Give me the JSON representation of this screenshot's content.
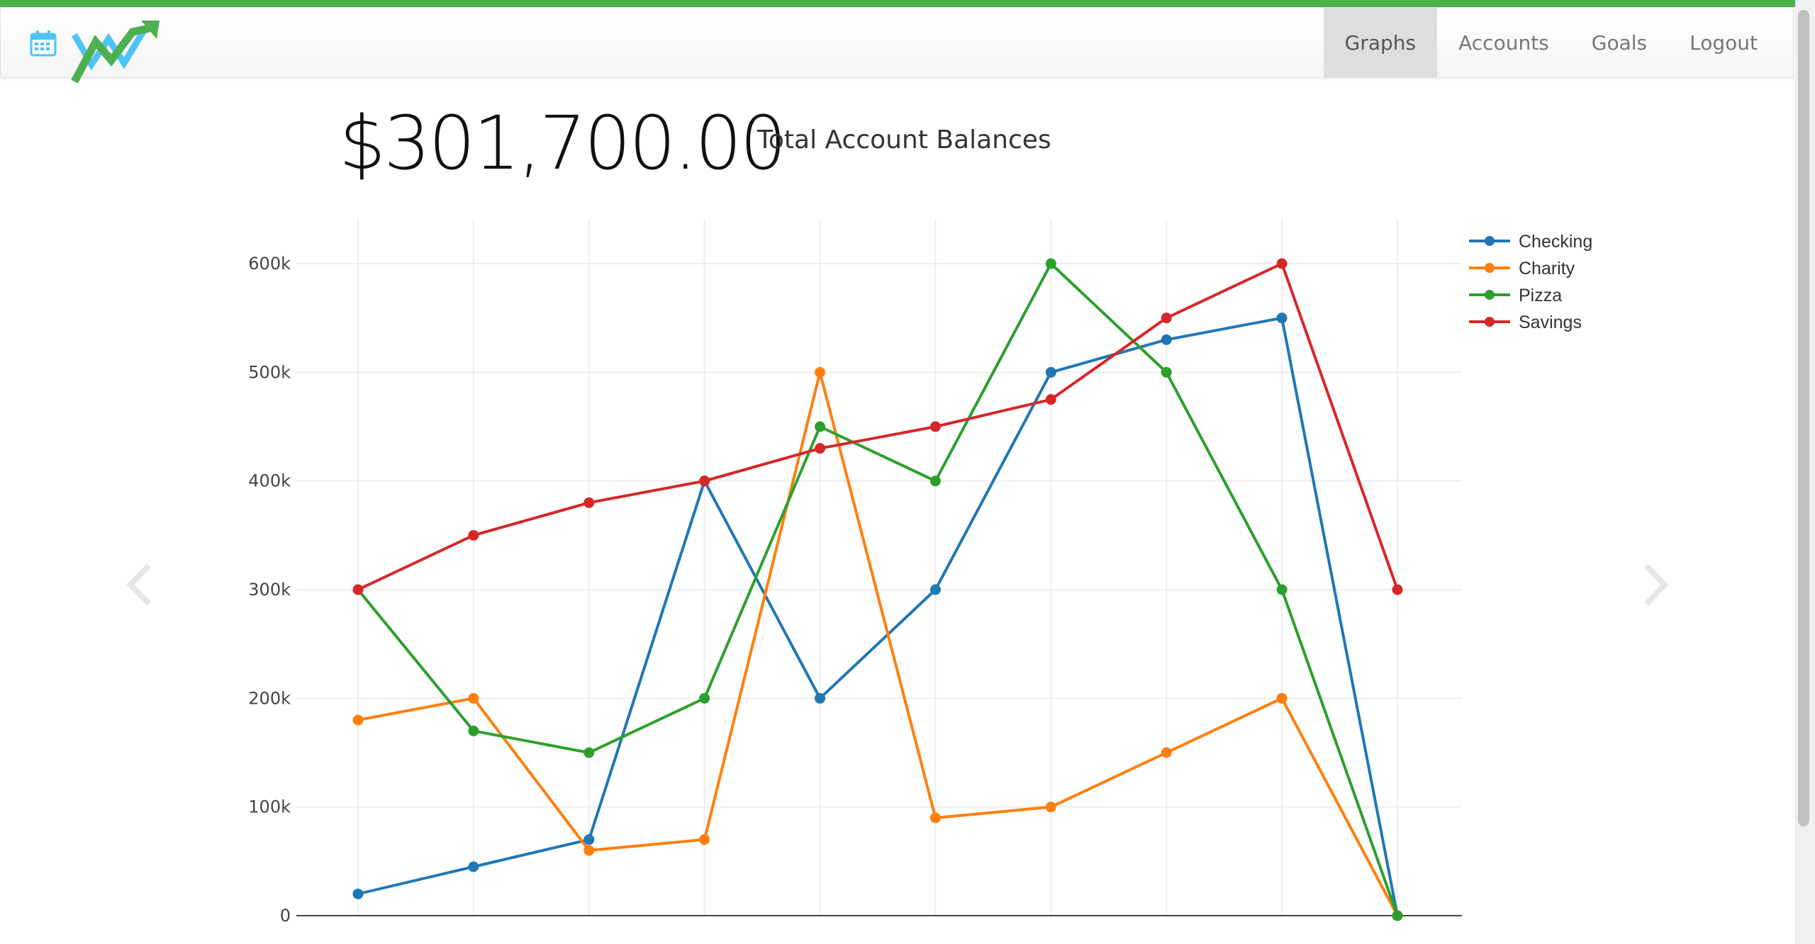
{
  "app": {
    "nav": {
      "items": [
        {
          "label": "Graphs",
          "active": true
        },
        {
          "label": "Accounts",
          "active": false
        },
        {
          "label": "Goals",
          "active": false
        },
        {
          "label": "Logout",
          "active": false
        }
      ]
    },
    "icons": {
      "calendar": "calendar-icon",
      "logo": "trend-arrow-logo",
      "prev": "chevron-left-icon",
      "next": "chevron-right-icon"
    },
    "colors": {
      "accent": "#4caf50",
      "calendar": "#4fc3f7"
    }
  },
  "summary": {
    "balance": "$301,700.00",
    "label": "Total Account Balances"
  },
  "chart_data": {
    "type": "line",
    "x": [
      1,
      2,
      3,
      4,
      5,
      6,
      7,
      8,
      9,
      10
    ],
    "ylim": [
      0,
      600000
    ],
    "yticks": [
      {
        "value": 0,
        "label": "0"
      },
      {
        "value": 100000,
        "label": "100k"
      },
      {
        "value": 200000,
        "label": "200k"
      },
      {
        "value": 300000,
        "label": "300k"
      },
      {
        "value": 400000,
        "label": "400k"
      },
      {
        "value": 500000,
        "label": "500k"
      },
      {
        "value": 600000,
        "label": "600k"
      }
    ],
    "grid": true,
    "legend_position": "top-right",
    "series": [
      {
        "name": "Checking",
        "color": "#1f77b4",
        "values": [
          20000,
          45000,
          70000,
          400000,
          200000,
          300000,
          500000,
          530000,
          550000,
          0
        ]
      },
      {
        "name": "Charity",
        "color": "#ff7f0e",
        "values": [
          180000,
          200000,
          60000,
          70000,
          500000,
          90000,
          100000,
          150000,
          200000,
          0
        ]
      },
      {
        "name": "Pizza",
        "color": "#2ca02c",
        "values": [
          300000,
          170000,
          150000,
          200000,
          450000,
          400000,
          600000,
          500000,
          300000,
          0
        ]
      },
      {
        "name": "Savings",
        "color": "#d62728",
        "values": [
          300000,
          350000,
          380000,
          400000,
          430000,
          450000,
          475000,
          550000,
          600000,
          300000
        ]
      }
    ]
  }
}
